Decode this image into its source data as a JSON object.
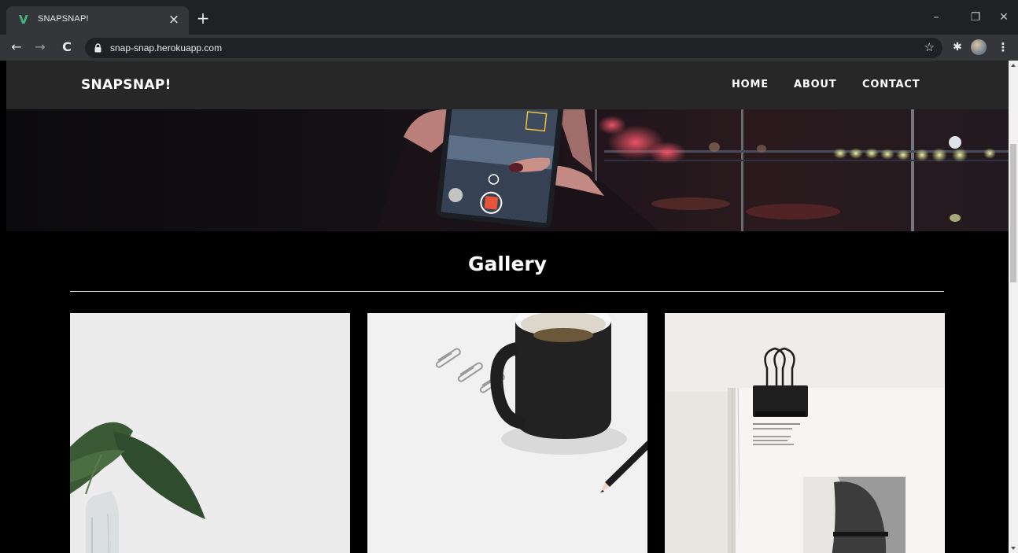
{
  "browser": {
    "tab_title": "SNAPSNAP!",
    "url": "snap-snap.herokuapp.com",
    "icons": [
      "vue-logo-icon",
      "close-icon",
      "new-tab-icon",
      "back-icon",
      "forward-icon",
      "reload-icon",
      "lock-icon",
      "star-icon",
      "extensions-icon",
      "profile-avatar",
      "menu-icon",
      "minimize-icon",
      "maximize-icon",
      "window-close-icon"
    ],
    "accent": "#41b883"
  },
  "site": {
    "brand": "SNAPSNAP!",
    "nav": [
      "HOME",
      "ABOUT",
      "CONTACT"
    ]
  },
  "gallery": {
    "title": "Gallery",
    "images": [
      "plant-in-glass-vase-photo",
      "coffee-mug-paperclips-pencil-photo",
      "binder-clip-open-book-photo"
    ]
  }
}
